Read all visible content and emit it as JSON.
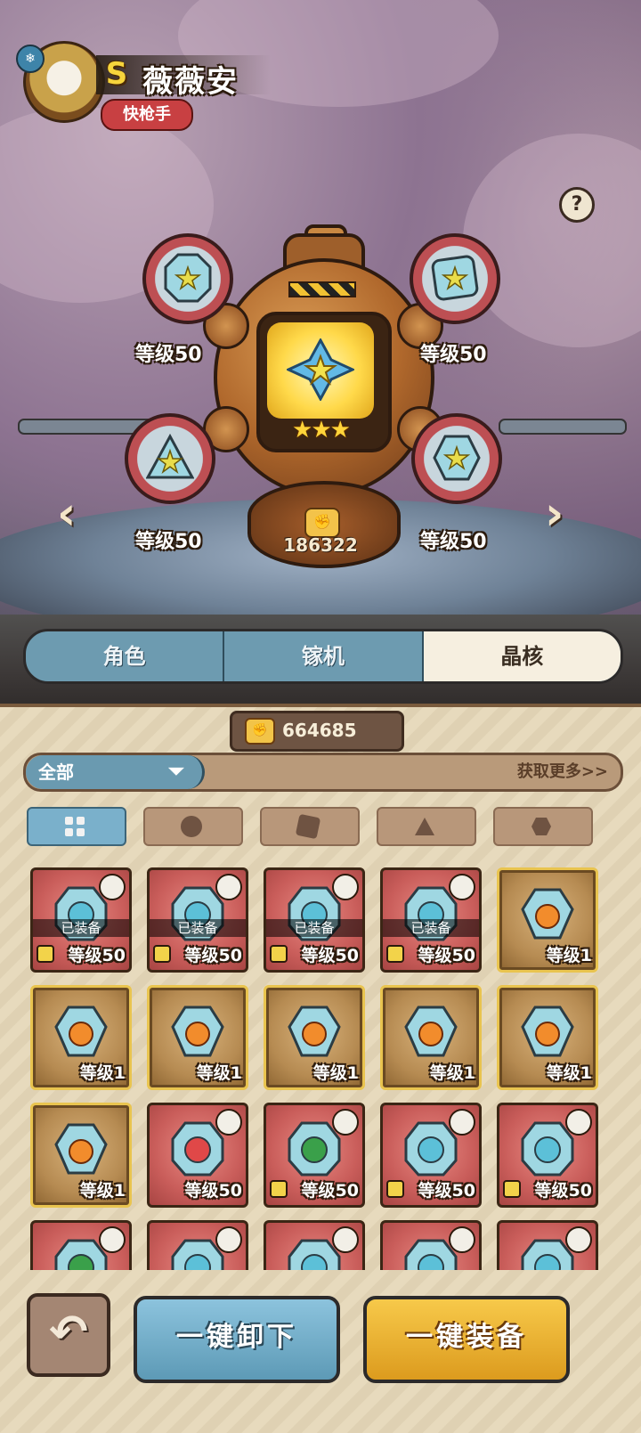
{
  "hero": {
    "rank": "S",
    "name": "薇薇安",
    "class": "快枪手"
  },
  "help_label": "?",
  "core_machine": {
    "stars": "★★★",
    "power": "186322"
  },
  "slots": [
    {
      "level": "等级50"
    },
    {
      "level": "等级50"
    },
    {
      "level": "等级50"
    },
    {
      "level": "等级50"
    }
  ],
  "tabs": [
    {
      "label": "角色",
      "active": false
    },
    {
      "label": "镓机",
      "active": false
    },
    {
      "label": "晶核",
      "active": true
    }
  ],
  "currency": {
    "value": "664685"
  },
  "filter": {
    "selected": "全部",
    "get_more": "获取更多>>"
  },
  "filter_tabs": [
    "all-icon",
    "circle-shape-icon",
    "square-shape-icon",
    "triangle-shape-icon",
    "hexagon-shape-icon"
  ],
  "inventory": [
    {
      "tier": "red",
      "equipped_label": "已装备",
      "level": "等级50",
      "locked": true,
      "gem_color": "#5cc0d8"
    },
    {
      "tier": "red",
      "equipped_label": "已装备",
      "level": "等级50",
      "locked": true,
      "gem_color": "#5cc0d8"
    },
    {
      "tier": "red",
      "equipped_label": "已装备",
      "level": "等级50",
      "locked": true,
      "gem_color": "#5cc0d8"
    },
    {
      "tier": "red",
      "equipped_label": "已装备",
      "level": "等级50",
      "locked": true,
      "gem_color": "#5cc0d8"
    },
    {
      "tier": "gold",
      "equipped_label": "",
      "level": "等级1",
      "locked": false,
      "gem_color": "#f28c2c"
    },
    {
      "tier": "gold",
      "equipped_label": "",
      "level": "等级1",
      "locked": false,
      "gem_color": "#f28c2c"
    },
    {
      "tier": "gold",
      "equipped_label": "",
      "level": "等级1",
      "locked": false,
      "gem_color": "#f28c2c"
    },
    {
      "tier": "gold",
      "equipped_label": "",
      "level": "等级1",
      "locked": false,
      "gem_color": "#f28c2c"
    },
    {
      "tier": "gold",
      "equipped_label": "",
      "level": "等级1",
      "locked": false,
      "gem_color": "#f28c2c"
    },
    {
      "tier": "gold",
      "equipped_label": "",
      "level": "等级1",
      "locked": false,
      "gem_color": "#f28c2c"
    },
    {
      "tier": "gold",
      "equipped_label": "",
      "level": "等级1",
      "locked": false,
      "gem_color": "#f28c2c"
    },
    {
      "tier": "red",
      "equipped_label": "",
      "level": "等级50",
      "locked": false,
      "gem_color": "#e04848"
    },
    {
      "tier": "red",
      "equipped_label": "",
      "level": "等级50",
      "locked": true,
      "gem_color": "#3aa04a"
    },
    {
      "tier": "red",
      "equipped_label": "",
      "level": "等级50",
      "locked": true,
      "gem_color": "#5cc0d8"
    },
    {
      "tier": "red",
      "equipped_label": "",
      "level": "等级50",
      "locked": true,
      "gem_color": "#5cc0d8"
    },
    {
      "tier": "red",
      "equipped_label": "",
      "level": "",
      "locked": false,
      "gem_color": "#3aa04a"
    },
    {
      "tier": "red",
      "equipped_label": "",
      "level": "",
      "locked": false,
      "gem_color": "#5cc0d8"
    },
    {
      "tier": "red",
      "equipped_label": "",
      "level": "",
      "locked": false,
      "gem_color": "#5cc0d8"
    },
    {
      "tier": "red",
      "equipped_label": "",
      "level": "",
      "locked": false,
      "gem_color": "#5cc0d8"
    },
    {
      "tier": "red",
      "equipped_label": "",
      "level": "",
      "locked": false,
      "gem_color": "#5cc0d8"
    }
  ],
  "buttons": {
    "back": "↶",
    "unequip_all": "一键卸下",
    "equip_all": "一键装备"
  }
}
